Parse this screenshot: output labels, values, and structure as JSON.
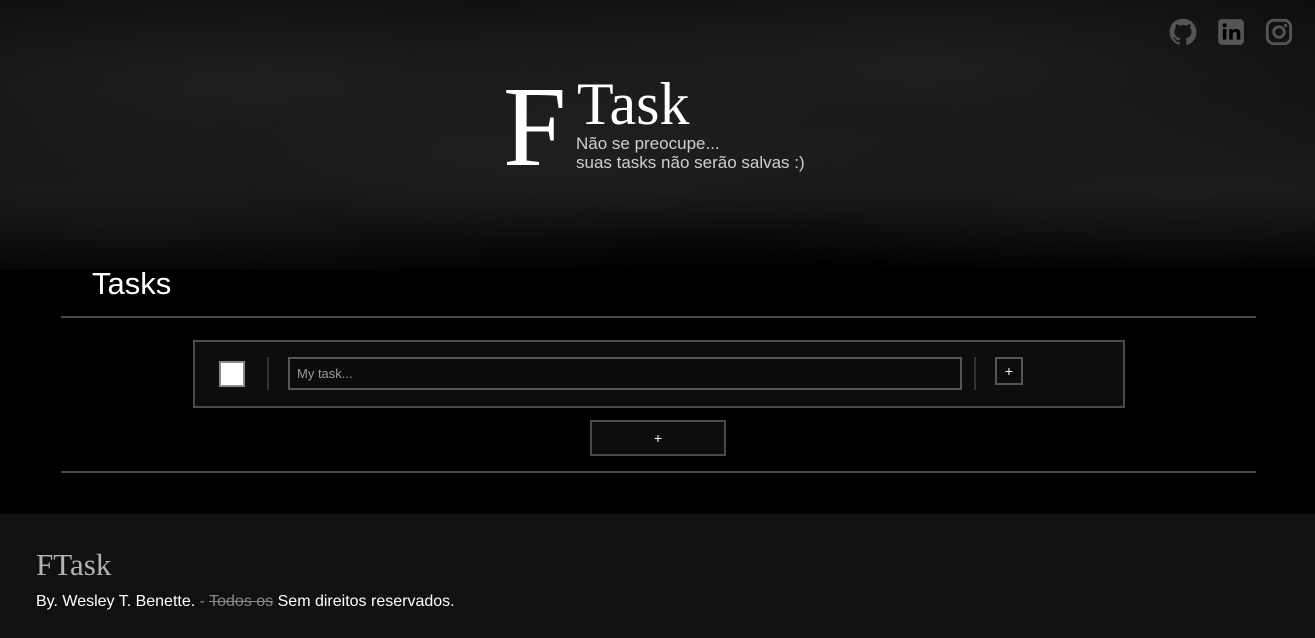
{
  "social": {
    "github_icon": "github-icon",
    "linkedin_icon": "linkedin-icon",
    "instagram_icon": "instagram-icon",
    "icon_color": "#555555"
  },
  "logo": {
    "letter": "F",
    "word": "Task",
    "subtitle_line1": "Não se preocupe...",
    "subtitle_line2": "suas tasks não serão salvas :)"
  },
  "main": {
    "section_title": "Tasks",
    "task_input_placeholder": "My task...",
    "add_subtask_label": "+",
    "add_task_label": "+"
  },
  "footer": {
    "brand": "FTask",
    "credit_author": "By. Wesley T. Benette.",
    "credit_separator": "-",
    "credit_struck": "Todos os",
    "credit_rest": "Sem direitos reservados."
  }
}
